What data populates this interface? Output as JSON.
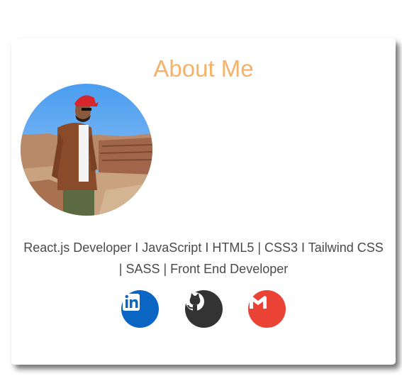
{
  "about": {
    "title": "About Me",
    "bio": "React.js Developer I JavaScript I HTML5 | CSS3 I Tailwind CSS | SASS | Front End Developer"
  },
  "socials": [
    {
      "name": "LinkedIn",
      "icon": "linkedin-icon",
      "color": "#0a66c2"
    },
    {
      "name": "GitHub",
      "icon": "github-icon",
      "color": "#333333"
    },
    {
      "name": "Gmail",
      "icon": "gmail-icon",
      "color": "#ea4335"
    }
  ],
  "colors": {
    "title": "#f5b26b",
    "text": "#4a4a4a"
  }
}
